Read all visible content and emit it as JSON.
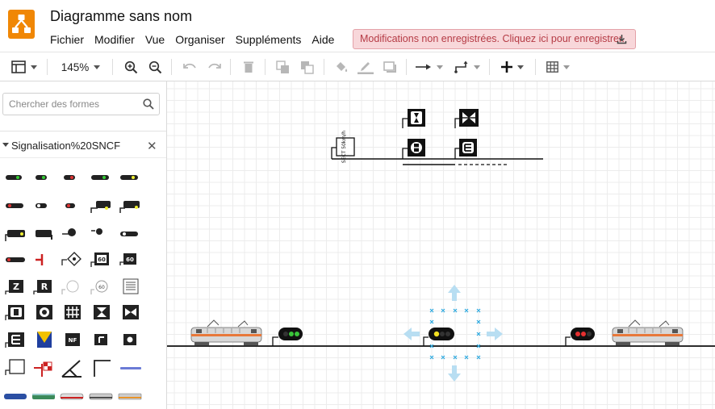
{
  "app": {
    "title": "Diagramme sans nom",
    "menu": [
      "Fichier",
      "Modifier",
      "Vue",
      "Organiser",
      "Suppléments",
      "Aide"
    ],
    "unsaved_notice": "Modifications non enregistrées. Cliquez ici pour enregistrer."
  },
  "toolbar": {
    "zoom": "145%",
    "items": [
      "format-panel",
      "zoom-in",
      "zoom-out",
      "undo",
      "redo",
      "delete",
      "to-front",
      "to-back",
      "fill-color",
      "line-color",
      "shadow",
      "connection",
      "waypoints",
      "insert",
      "table"
    ]
  },
  "sidebar": {
    "search_placeholder": "Chercher des formes",
    "library_title": "Signalisation%20SNCF",
    "shape_rows": 9
  },
  "canvas": {
    "board_label": "SECT 50km/h",
    "tracks": 2,
    "signals": [
      {
        "name": "left-signal",
        "aspect": "green"
      },
      {
        "name": "middle-signal",
        "aspect": "yellow"
      },
      {
        "name": "right-signal",
        "aspect": "red"
      }
    ],
    "trains": [
      "left-locomotive",
      "right-locomotive"
    ]
  },
  "colors": {
    "brand": "#f08705",
    "notice_bg": "#f8d7da",
    "notice_text": "#b53b45",
    "selection": "#29a8e0"
  }
}
